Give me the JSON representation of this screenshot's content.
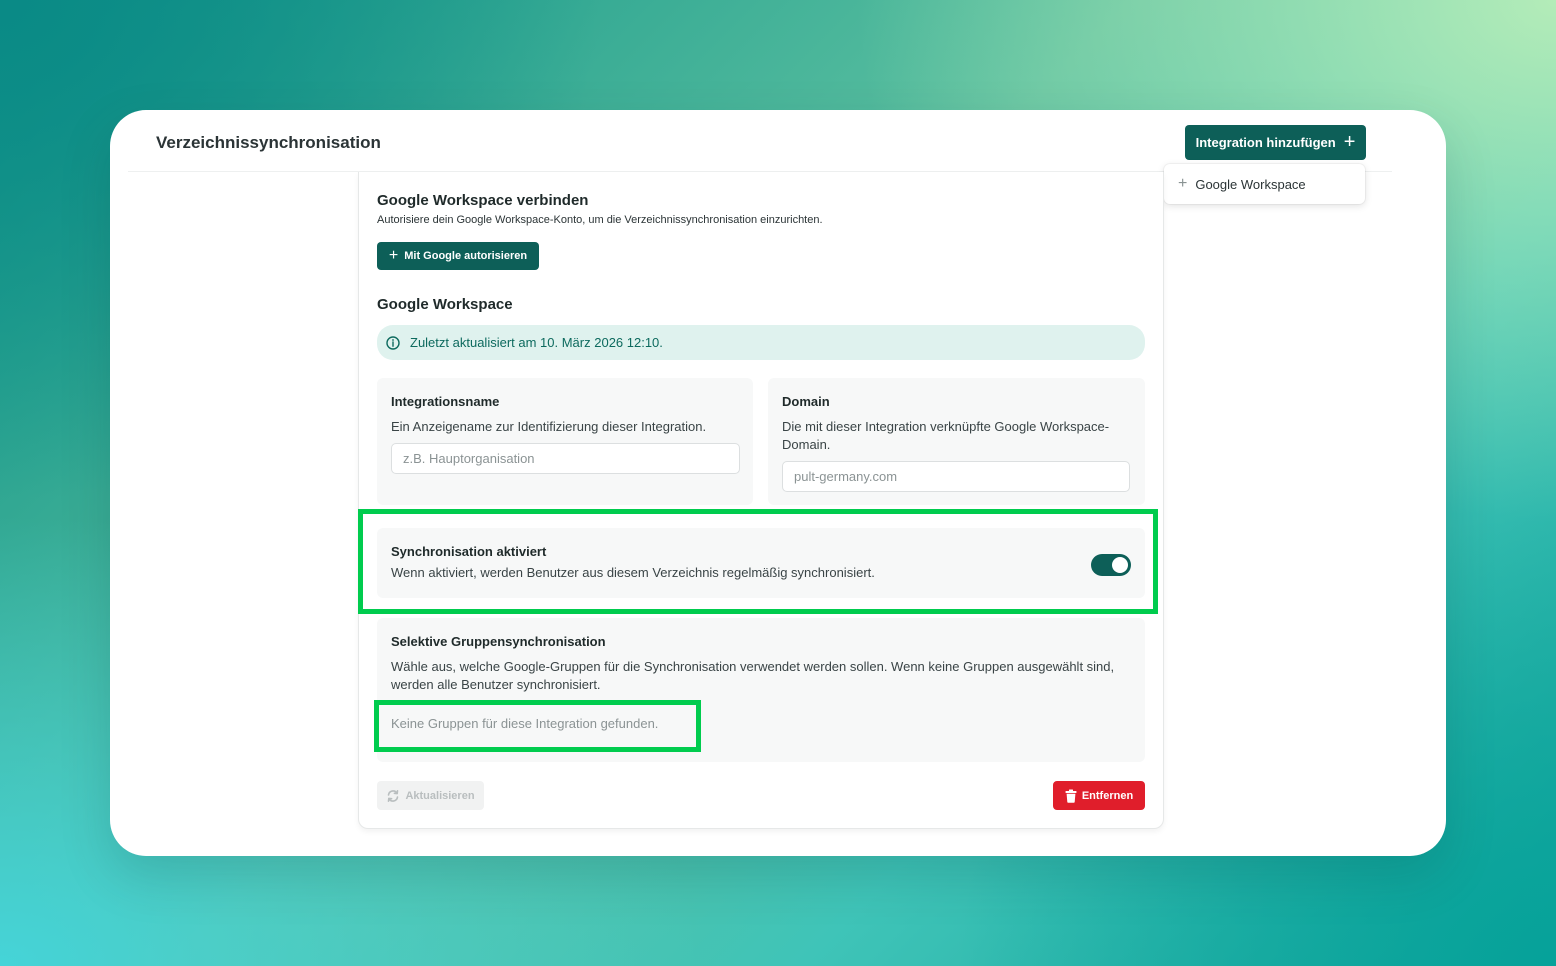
{
  "header": {
    "title": "Verzeichnissynchronisation",
    "add_button_label": "Integration hinzufügen",
    "add_button_icon": "plus-icon"
  },
  "dropdown": {
    "items": [
      {
        "label": "Google Workspace",
        "icon": "plus-icon"
      }
    ]
  },
  "connect": {
    "title": "Google Workspace verbinden",
    "description": "Autorisiere dein Google Workspace-Konto, um die Verzeichnissynchronisation einzurichten.",
    "button_label": "Mit Google autorisieren"
  },
  "integration": {
    "title": "Google Workspace",
    "info_text": "Zuletzt aktualisiert am 10. März 2026 12:10.",
    "name_field": {
      "label": "Integrationsname",
      "description": "Ein Anzeigename zur Identifizierung dieser Integration.",
      "value": "",
      "placeholder": "z.B. Hauptorganisation"
    },
    "domain_field": {
      "label": "Domain",
      "description": "Die mit dieser Integration verknüpfte Google Workspace-Domain.",
      "value": "",
      "placeholder": "pult-germany.com"
    },
    "sync": {
      "label": "Synchronisation aktiviert",
      "description": "Wenn aktiviert, werden Benutzer aus diesem Verzeichnis regelmäßig synchronisiert.",
      "enabled": true
    },
    "group_sync": {
      "label": "Selektive Gruppensynchronisation",
      "description": "Wähle aus, welche Google-Gruppen für die Synchronisation verwendet werden sollen. Wenn keine Gruppen ausgewählt sind, werden alle Benutzer synchronisiert.",
      "empty_text": "Keine Gruppen für diese Integration gefunden."
    },
    "refresh_label": "Aktualisieren",
    "remove_label": "Entfernen"
  },
  "colors": {
    "primary": "#0d5f58",
    "danger": "#e01e2b",
    "info_bg": "#dff2ee",
    "highlight": "#00cc4e"
  }
}
